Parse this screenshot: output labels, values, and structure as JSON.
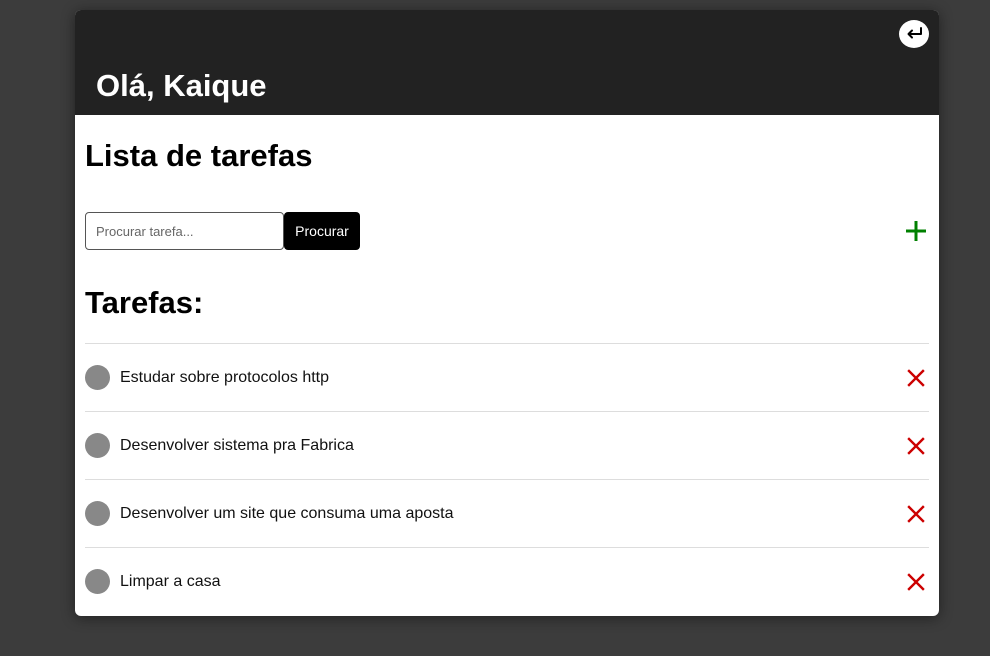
{
  "header": {
    "greeting": "Olá, Kaique"
  },
  "main": {
    "title": "Lista de tarefas",
    "tasks_title": "Tarefas:"
  },
  "search": {
    "placeholder": "Procurar tarefa...",
    "value": "",
    "button_label": "Procurar"
  },
  "icons": {
    "logout": "return-arrow-icon",
    "add": "plus-icon",
    "delete": "x-icon",
    "toggle": "circle-icon"
  },
  "colors": {
    "header_bg": "#222222",
    "add_icon": "#008000",
    "delete_icon": "#cc0000",
    "toggle": "#888888"
  },
  "tasks": [
    {
      "text": "Estudar sobre protocolos http"
    },
    {
      "text": "Desenvolver sistema pra Fabrica"
    },
    {
      "text": "Desenvolver um site que consuma uma aposta"
    },
    {
      "text": "Limpar a casa"
    }
  ]
}
